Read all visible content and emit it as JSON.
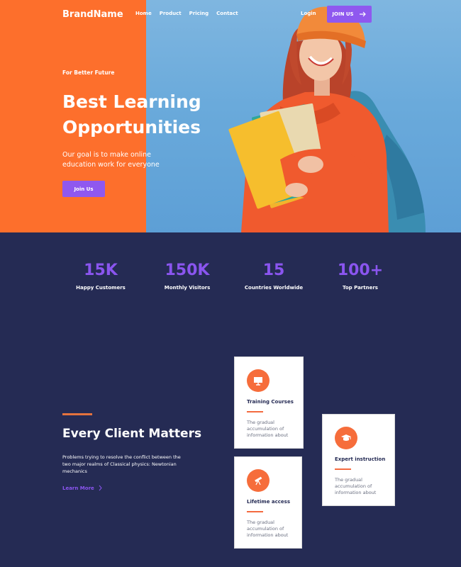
{
  "brand": "BrandName",
  "nav": [
    "Home",
    "Product",
    "Pricing",
    "Contact"
  ],
  "header": {
    "login": "Login",
    "join_label": "JOIN US"
  },
  "hero": {
    "kicker": "For Better Future",
    "title_line1": "Best Learning",
    "title_line2": "Opportunities",
    "subtitle": "Our goal is to make online education work for everyone",
    "cta": "Join Us"
  },
  "stats": [
    {
      "value": "15K",
      "label": "Happy Customers"
    },
    {
      "value": "150K",
      "label": "Monthly Visitors"
    },
    {
      "value": "15",
      "label": "Countries  Worldwide"
    },
    {
      "value": "100+",
      "label": "Top Partners"
    }
  ],
  "features": {
    "title": "Every Client Matters",
    "text": "Problems trying to resolve the conflict between the two major realms of Classical physics: Newtonian mechanics",
    "link": "Learn More",
    "cards": [
      {
        "icon": "presentation-board-icon",
        "title": "Training Courses",
        "text": "The gradual accumulation of information about"
      },
      {
        "icon": "telescope-icon",
        "title": "Lifetime access",
        "text": "The gradual accumulation of information about"
      },
      {
        "icon": "graduation-cap-icon",
        "title": "Expert instruction",
        "text": "The gradual accumulation of information about"
      }
    ]
  },
  "colors": {
    "orange": "#fd6f2c",
    "purple": "#8f58ef",
    "navy": "#252b54",
    "sky": "#6aaadb"
  }
}
